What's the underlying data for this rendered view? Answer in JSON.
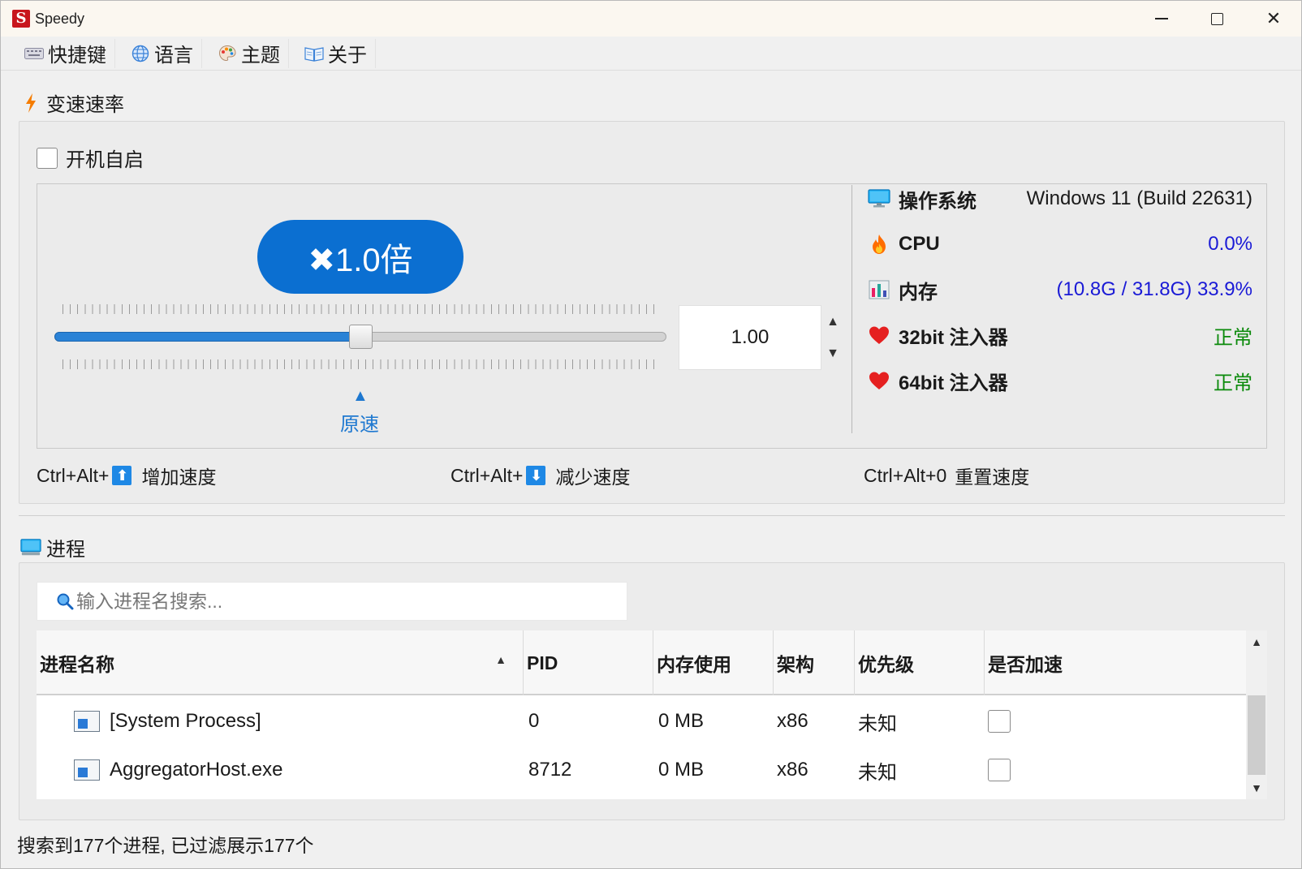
{
  "window": {
    "title": "Speedy",
    "logo_letter": "S",
    "minimize_icon": "minimize-icon",
    "maximize_icon": "maximize-icon",
    "close_icon": "close-icon",
    "close_glyph": "✕"
  },
  "menu": [
    {
      "label": "快捷键",
      "icon": "keyboard-icon"
    },
    {
      "label": "语言",
      "icon": "globe-icon"
    },
    {
      "label": "主题",
      "icon": "palette-icon"
    },
    {
      "label": "关于",
      "icon": "book-icon"
    }
  ],
  "speed": {
    "group_title": "变速速率",
    "group_icon": "lightning-icon",
    "autostart_label": "开机自启",
    "autostart_checked": false,
    "pill_text": "✖1.0倍",
    "slider_fraction": 0.5,
    "spin_value": "1.00",
    "spin_up": "▲",
    "spin_down": "▼",
    "origin_arrow": "▲",
    "origin_label": "原速"
  },
  "system": {
    "os_label": "操作系统",
    "os_value": "Windows 11 (Build 22631)",
    "cpu_label": "CPU",
    "cpu_value": "0.0%",
    "mem_label": "内存",
    "mem_value": "(10.8G / 31.8G) 33.9%",
    "inj32_label": "32bit 注入器",
    "inj32_value": "正常",
    "inj64_label": "64bit 注入器",
    "inj64_value": "正常"
  },
  "hotkeys": [
    {
      "prefix": "Ctrl+Alt+",
      "key": "⬆",
      "action": "增加速度"
    },
    {
      "prefix": "Ctrl+Alt+",
      "key": "⬇",
      "action": "减少速度"
    },
    {
      "prefix": "Ctrl+Alt+0",
      "key": "",
      "action": "重置速度"
    }
  ],
  "process": {
    "group_title": "进程",
    "search_placeholder": "输入进程名搜索...",
    "columns": [
      "进程名称",
      "PID",
      "内存使用",
      "架构",
      "优先级",
      "是否加速"
    ],
    "sort_arrow": "▲",
    "scroll_up": "▲",
    "scroll_down": "▼",
    "rows": [
      {
        "name": "[System Process]",
        "pid": "0",
        "memory": "0 MB",
        "arch": "x86",
        "priority": "未知",
        "accelerated": false
      },
      {
        "name": "AggregatorHost.exe",
        "pid": "8712",
        "memory": "0 MB",
        "arch": "x86",
        "priority": "未知",
        "accelerated": false
      }
    ]
  },
  "status": "搜索到177个进程, 已过滤展示177个",
  "colors": {
    "accent": "#0b6fd1",
    "value_blue": "#1a1ad6",
    "value_green": "#0b8a0b",
    "heart_red": "#e52020",
    "logo_red": "#c8161d"
  }
}
